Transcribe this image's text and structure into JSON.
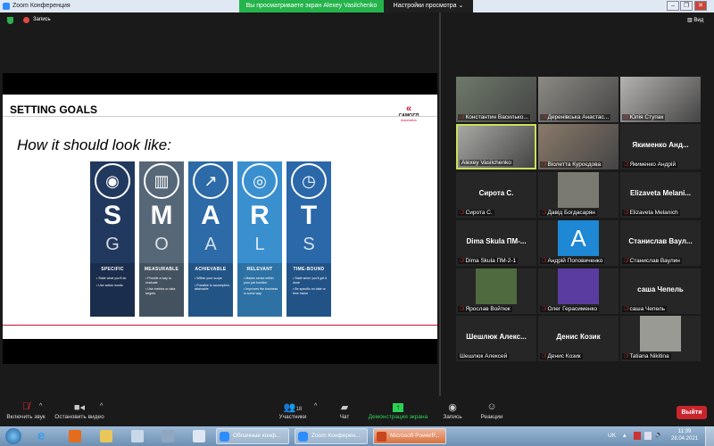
{
  "window": {
    "title": "Zoom Конференция",
    "banner": "Вы просматриваете экран Alexey Vasilchenko",
    "view_options": "Настройки просмотра ⌄",
    "minimize": "–",
    "maximize": "❐",
    "close": "✕"
  },
  "topbar": {
    "recording": "Запись",
    "view": "Вид"
  },
  "slide": {
    "title": "SETTING GOALS",
    "logo": "CAMOZZI",
    "logo_sub": "Automation",
    "subtitle": "How it should look like:",
    "pillars": [
      {
        "icon": "◉",
        "letter": "S",
        "word": "G",
        "label": "SPECIFIC",
        "bullets": [
          "State what you'll do",
          "Use action words"
        ],
        "color": "#22395f"
      },
      {
        "icon": "▥",
        "letter": "M",
        "word": "O",
        "label": "MEASURABLE",
        "bullets": [
          "Provide a way to evaluate",
          "Use metrics or data targets"
        ],
        "color": "#566778"
      },
      {
        "icon": "↗",
        "letter": "A",
        "word": "A",
        "label": "ACHIEVABLE",
        "bullets": [
          "Within your scope",
          "Possible to accomplish, attainable"
        ],
        "color": "#2c6aa8"
      },
      {
        "icon": "◎",
        "letter": "R",
        "word": "L",
        "label": "RELEVANT",
        "bullets": [
          "Makes sense within your job function",
          "Improves the business in some way"
        ],
        "color": "#3a8fcf"
      },
      {
        "icon": "◷",
        "letter": "T",
        "word": "S",
        "label": "TIME-BOUND",
        "bullets": [
          "State when you'll get it done",
          "Be specific on date or time frame"
        ],
        "color": "#2b68a9"
      }
    ]
  },
  "participants": [
    {
      "name": "Константин Василько...",
      "muted": true,
      "video": "#6f7a6a"
    },
    {
      "name": "Деренівська Анастас...",
      "muted": true,
      "video": "#8d8a84"
    },
    {
      "name": "Юлія Ступак",
      "muted": true,
      "video": "#b5b3b0"
    },
    {
      "name": "Alexey Vasilchenko",
      "muted": false,
      "video": "#a8a8a4",
      "active": true
    },
    {
      "name": "Віолетта Куроєдова",
      "muted": true,
      "video": "#8a7a6a"
    },
    {
      "name": "Якименко Андрій",
      "center": "Якименко Анд...",
      "muted": true
    },
    {
      "name": "Сирота С.",
      "center": "Сирота С.",
      "muted": true
    },
    {
      "name": "Давід Богдасарян",
      "muted": true,
      "avatar": "#7a7a70"
    },
    {
      "name": "Elizaveta Melanich",
      "center": "Elizaveta Melani...",
      "muted": true
    },
    {
      "name": "Dima Skula ПМ-2-1",
      "center": "Dima Skula ПМ-...",
      "muted": true
    },
    {
      "name": "Андрій Поповиченко",
      "muted": true,
      "avatar": "#1e88d4",
      "avatar_letter": "A"
    },
    {
      "name": "Станислав Ваулин",
      "center": "Станислав Ваул...",
      "muted": true
    },
    {
      "name": "Ярослав Войтюк",
      "muted": true,
      "avatar": "#4f6a3e"
    },
    {
      "name": "Олег Герасименко",
      "muted": true,
      "avatar": "#5a3ba0"
    },
    {
      "name": "саша Чепель",
      "center": "саша Чепель",
      "muted": true
    },
    {
      "name": "Шешлюк Алексей",
      "center": "Шешлюк Алекс...",
      "muted": false
    },
    {
      "name": "Денис Козик",
      "center": "Денис Козик",
      "muted": true
    },
    {
      "name": "Tatiana Nikitina",
      "muted": true,
      "avatar": "#9a9a94"
    }
  ],
  "toolbar": {
    "unmute": "Включить звук",
    "stop_video": "Остановить видео",
    "participants": "Участники",
    "participants_count": "18",
    "chat": "Чат",
    "share": "Демонстрация экрана",
    "record": "Запись",
    "reactions": "Реакции",
    "leave": "Выйти"
  },
  "taskbar": {
    "tasks": [
      "Облачные конф...",
      "Zoom Конферен...",
      "Microsoft PowerP..."
    ],
    "lang": "UK",
    "time": "11:39",
    "date": "28.04.2021"
  }
}
